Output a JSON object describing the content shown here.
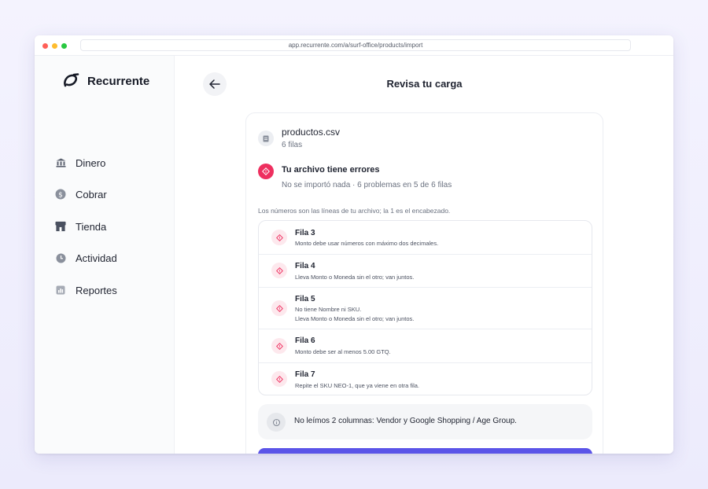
{
  "browser": {
    "url": "app.recurrente.com/a/surf-office/products/import"
  },
  "sidebar": {
    "brand": "Recurrente",
    "items": [
      {
        "label": "Dinero",
        "icon": "bank-icon"
      },
      {
        "label": "Cobrar",
        "icon": "dollar-coin-icon"
      },
      {
        "label": "Tienda",
        "icon": "store-icon"
      },
      {
        "label": "Actividad",
        "icon": "clock-icon"
      },
      {
        "label": "Reportes",
        "icon": "report-chart-icon"
      }
    ]
  },
  "header": {
    "title": "Revisa tu carga",
    "back_icon": "arrow-left-icon"
  },
  "file": {
    "name": "productos.csv",
    "rows": "6 filas"
  },
  "error_summary": {
    "title": "Tu archivo tiene errores",
    "subtitle": "No se importó nada · 6 problemas en 5 de 6 filas"
  },
  "hint": "Los números son las líneas de tu archivo; la 1 es el encabezado.",
  "errors": [
    {
      "title": "Fila 3",
      "messages": [
        "Monto debe usar números con máximo dos decimales."
      ]
    },
    {
      "title": "Fila 4",
      "messages": [
        "Lleva Monto o Moneda sin el otro; van juntos."
      ]
    },
    {
      "title": "Fila 5",
      "messages": [
        "No tiene Nombre ni SKU.",
        "Lleva Monto o Moneda sin el otro; van juntos."
      ]
    },
    {
      "title": "Fila 6",
      "messages": [
        "Monto debe ser al menos 5.00 GTQ."
      ]
    },
    {
      "title": "Fila 7",
      "messages": [
        "Repite el SKU NEO-1, que ya viene en otra fila."
      ]
    }
  ],
  "notice": {
    "text": "No leímos 2 columnas: Vendor y Google Shopping / Age Group."
  },
  "colors": {
    "accent": "#5b54e8",
    "error": "#ee2f5f",
    "error_soft": "#fde8ed"
  }
}
